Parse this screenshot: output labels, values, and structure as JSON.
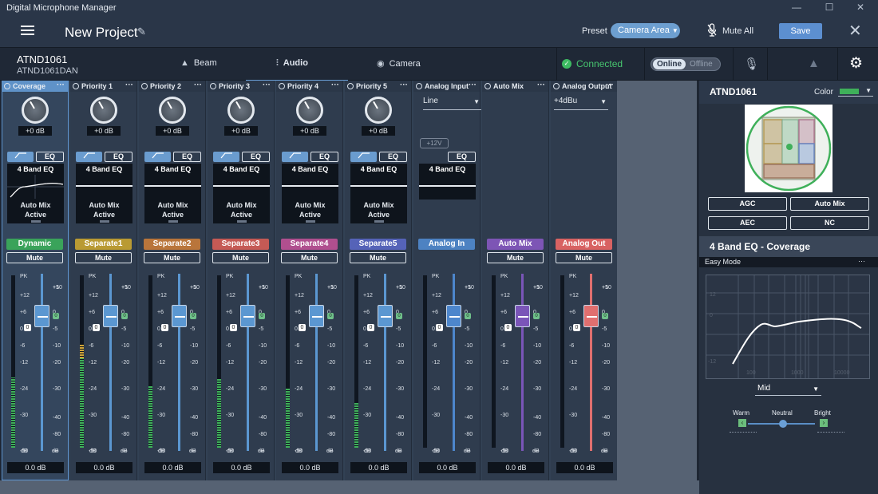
{
  "window": {
    "title": "Digital Microphone Manager",
    "minimize": "—",
    "maximize": "☐",
    "close": "✕"
  },
  "toolbar": {
    "project": "New Project",
    "preset_label": "Preset",
    "preset_value": "Camera Area",
    "mute_all": "Mute All",
    "save": "Save"
  },
  "device": {
    "name": "ATND1061",
    "sub": "ATND1061DAN"
  },
  "tabs": [
    {
      "label": "Beam",
      "icon": "beam-icon"
    },
    {
      "label": "Audio",
      "icon": "sliders-icon",
      "active": true
    },
    {
      "label": "Camera",
      "icon": "camera-icon"
    }
  ],
  "status": {
    "connected": "Connected",
    "online": "Online",
    "offline": "Offline"
  },
  "strips": [
    {
      "header": "Coverage",
      "gain": "+0 dB",
      "eq": "EQ",
      "eq_label": "4 Band EQ",
      "automix": "Auto Mix",
      "automix_state": "Active",
      "group": "Dynamic",
      "group_color": "#3aa35a",
      "mute": "Mute",
      "fader_color": "#5b97d1",
      "level_db": "0.0 dB",
      "meter": 0.66,
      "selected": true
    },
    {
      "header": "Priority 1",
      "gain": "+0 dB",
      "eq": "EQ",
      "eq_label": "4 Band EQ",
      "automix": "Auto Mix",
      "automix_state": "Active",
      "group": "Separate1",
      "group_color": "#b99a33",
      "mute": "Mute",
      "fader_color": "#5b97d1",
      "level_db": "0.0 dB",
      "meter": 0.84
    },
    {
      "header": "Priority 2",
      "gain": "+0 dB",
      "eq": "EQ",
      "eq_label": "4 Band EQ",
      "automix": "Auto Mix",
      "automix_state": "Active",
      "group": "Separate2",
      "group_color": "#b9753b",
      "mute": "Mute",
      "fader_color": "#5b97d1",
      "level_db": "0.0 dB",
      "meter": 0.58
    },
    {
      "header": "Priority 3",
      "gain": "+0 dB",
      "eq": "EQ",
      "eq_label": "4 Band EQ",
      "automix": "Auto Mix",
      "automix_state": "Active",
      "group": "Separate3",
      "group_color": "#c55a55",
      "mute": "Mute",
      "fader_color": "#5b97d1",
      "level_db": "0.0 dB",
      "meter": 0.65
    },
    {
      "header": "Priority 4",
      "gain": "+0 dB",
      "eq": "EQ",
      "eq_label": "4 Band EQ",
      "automix": "Auto Mix",
      "automix_state": "Active",
      "group": "Separate4",
      "group_color": "#b04f8f",
      "mute": "Mute",
      "fader_color": "#5b97d1",
      "level_db": "0.0 dB",
      "meter": 0.56
    },
    {
      "header": "Priority 5",
      "gain": "+0 dB",
      "eq": "EQ",
      "eq_label": "4 Band EQ",
      "automix": "Auto Mix",
      "automix_state": "Active",
      "group": "Separate5",
      "group_color": "#5563b8",
      "mute": "Mute",
      "fader_color": "#5b97d1",
      "level_db": "0.0 dB",
      "meter": 0.42
    },
    {
      "header": "Analog Input",
      "select": "Line",
      "phantom": "+12V",
      "eq": "EQ",
      "eq_label": "4 Band EQ",
      "group": "Analog In",
      "group_color": "#4d82c2",
      "fader_color": "#4d86cc",
      "level_db": "0.0 dB",
      "meter": 0
    },
    {
      "header": "Auto Mix",
      "group": "Auto Mix",
      "group_color": "#7d55b5",
      "mute": "Mute",
      "fader_color": "#7a55b8",
      "level_db": "0.0 dB",
      "meter": 0
    },
    {
      "header": "Analog Output",
      "select": "+4dBu",
      "group": "Analog Out",
      "group_color": "#d86262",
      "mute": "Mute",
      "fader_color": "#e06f6f",
      "level_db": "0.0 dB",
      "meter": 0
    }
  ],
  "meter_scale": [
    "PK",
    "+12",
    "+6",
    "0",
    "-6",
    "-12",
    "-24",
    "-30",
    "-50"
  ],
  "fader_scale": [
    "+10",
    "+5",
    "0",
    "-5",
    "-10",
    "-20",
    "-30",
    "-40",
    "-80",
    "-∞"
  ],
  "db_unit": "dB",
  "right_panel": {
    "device": "ATND1061",
    "color_label": "Color",
    "color_value": "#3fb05a",
    "buttons": [
      "AGC",
      "Auto Mix",
      "AEC",
      "NC"
    ],
    "eq_title": "4 Band EQ - Coverage",
    "mode": "Easy Mode",
    "graph_y": [
      "12",
      "0",
      "-12"
    ],
    "graph_x": [
      "100",
      "1000",
      "10000"
    ],
    "tone": "Mid",
    "warm": "Warm",
    "neutral": "Neutral",
    "bright": "Bright"
  }
}
